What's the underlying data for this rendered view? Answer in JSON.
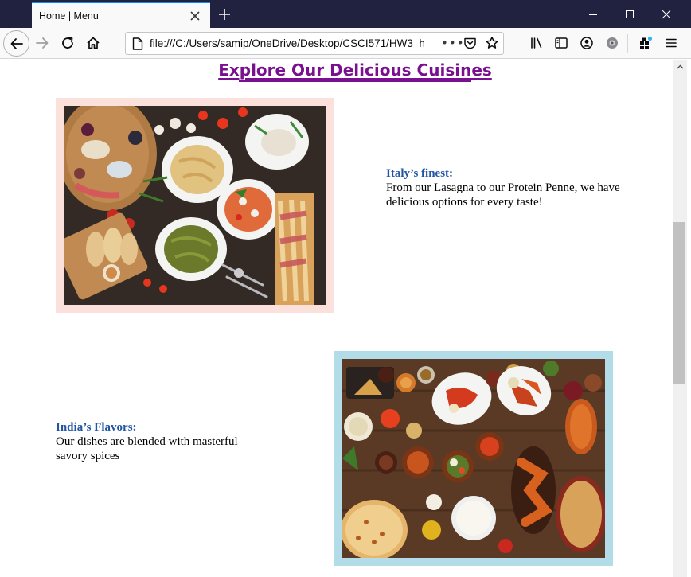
{
  "browser": {
    "tab_title": "Home | Menu",
    "url": "file:///C:/Users/samip/OneDrive/Desktop/CSCI571/HW3_h",
    "more_label": "•••"
  },
  "page": {
    "title": "Explore Our Delicious Cuisines",
    "italy": {
      "heading": "Italy’s finest:",
      "text": "From our Lasagna to our Protein Penne, we have delicious options for every taste!"
    },
    "india": {
      "heading": "India’s Flavors:",
      "text": "Our dishes are blended with masterful savory spices"
    }
  },
  "colors": {
    "title": "#7a0f8f",
    "heading": "#2255a4",
    "italy_frame": "#fce0dc",
    "india_frame": "#b2dde8",
    "titlebar": "#20223f"
  },
  "icons": {
    "back": "back-arrow-icon",
    "forward": "forward-arrow-icon",
    "reload": "reload-icon",
    "home": "home-icon",
    "page": "page-icon",
    "pocket": "pocket-icon",
    "bookmark": "star-icon",
    "library": "library-icon",
    "sidebar": "sidebar-icon",
    "account": "account-icon",
    "extension": "extension-icon",
    "addons": "addons-icon",
    "menu": "hamburger-menu-icon"
  }
}
